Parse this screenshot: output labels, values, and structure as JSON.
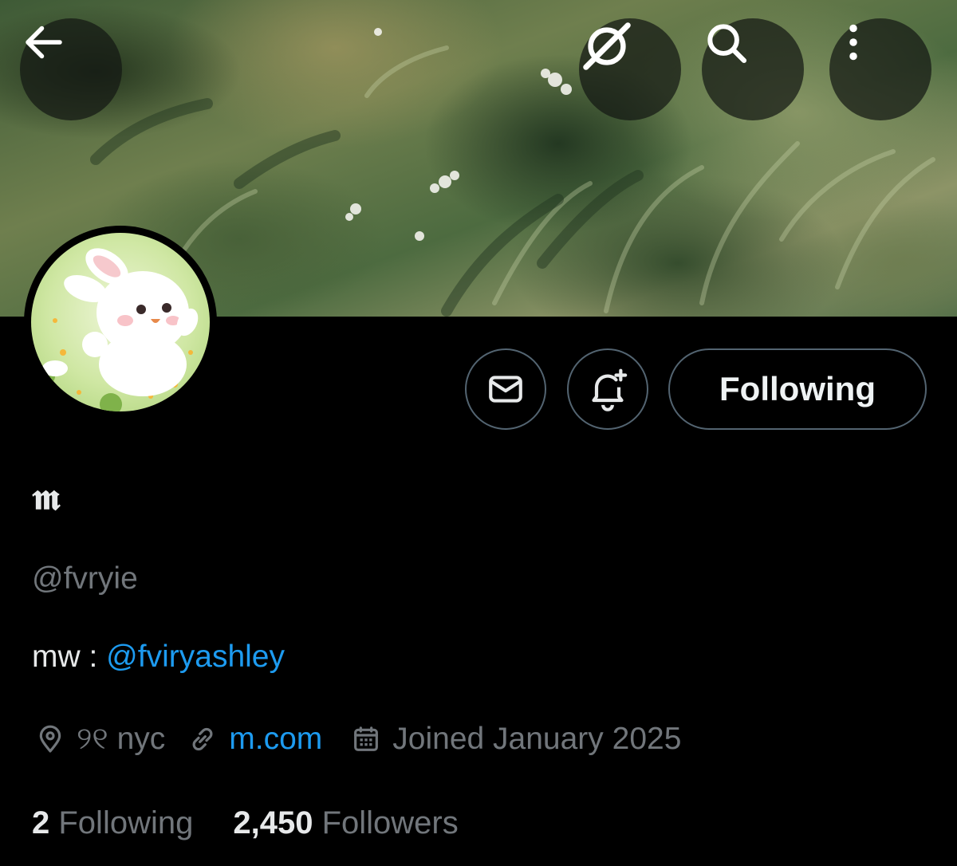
{
  "header": {
    "back_icon": "arrow-left-icon",
    "grok_icon": "grok-icon",
    "search_icon": "search-icon",
    "more_icon": "more-vertical-icon"
  },
  "profile": {
    "display_name": "𝖒",
    "handle": "@fvryie",
    "bio_prefix": "mw : ",
    "bio_mention": "@fviryashley",
    "location": "୨୧ nyc",
    "website": "m.com",
    "joined": "Joined January 2025",
    "following_count": "2",
    "following_label": "Following",
    "followers_count": "2,450",
    "followers_label": "Followers"
  },
  "actions": {
    "message_icon": "envelope-icon",
    "notify_icon": "bell-plus-icon",
    "follow_state": "Following"
  },
  "colors": {
    "background": "#000000",
    "accent_link": "#1d9bf0",
    "secondary_text": "#71767b",
    "button_border": "#536471"
  }
}
